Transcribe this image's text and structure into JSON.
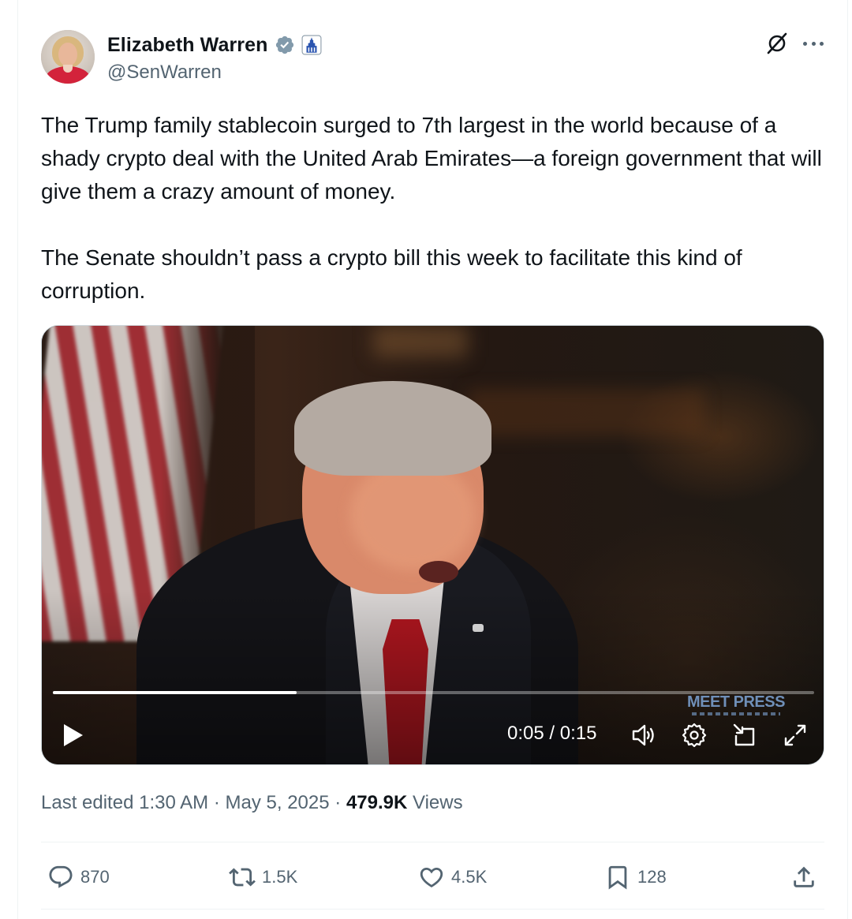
{
  "author": {
    "name": "Elizabeth Warren",
    "handle": "@SenWarren",
    "verified_color": "#829aab"
  },
  "tweet": {
    "paragraphs": [
      "The Trump family stablecoin surged to 7th largest in the world because of a shady crypto deal with the United Arab Emirates—a foreign government that will give them a crazy amount of money.",
      "The Senate shouldn’t pass a crypto bill this week to facilitate this kind of corruption."
    ]
  },
  "video": {
    "time": "0:05 / 0:15",
    "progress_fraction": 0.32,
    "watermark": "MEET PRESS"
  },
  "meta": {
    "edited": "Last edited 1:30 AM",
    "date": "May 5, 2025",
    "views_count": "479.9K",
    "views_label": "Views"
  },
  "actions": {
    "replies": "870",
    "reposts": "1.5K",
    "likes": "4.5K",
    "bookmarks": "128"
  },
  "colors": {
    "text": "#0f1419",
    "secondary": "#536471",
    "divider": "#eff3f4"
  }
}
